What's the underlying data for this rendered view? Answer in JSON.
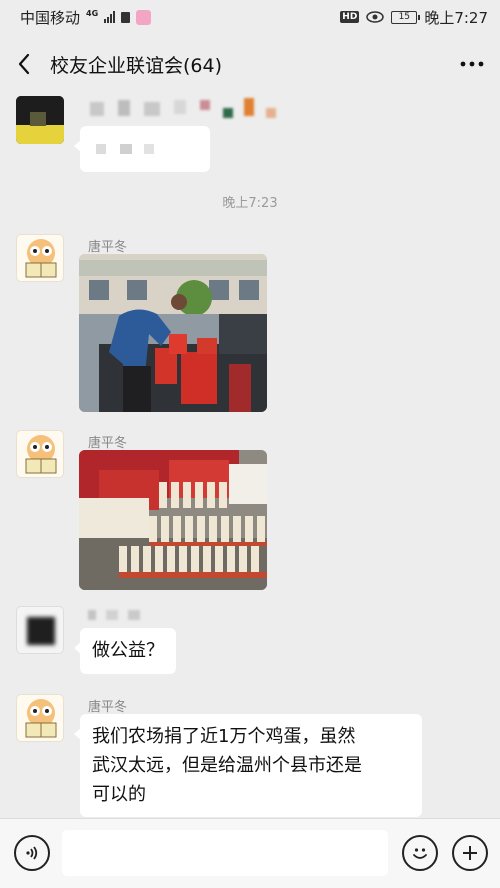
{
  "status_bar": {
    "carrier": "中国移动",
    "network": "4G",
    "hd": "HD",
    "battery": "15",
    "time": "晚上7:27"
  },
  "nav": {
    "title": "校友企业联谊会(64)",
    "back_icon": "chevron-left-icon",
    "more_icon": "more-dots-icon"
  },
  "chat": {
    "timestamp": "晚上7:23",
    "messages": [
      {
        "sender": "唐平冬",
        "type": "image",
        "description_icon": "photo-truck-loading"
      },
      {
        "sender": "唐平冬",
        "type": "image",
        "description_icon": "photo-donated-goods"
      },
      {
        "sender": "",
        "type": "text",
        "text": "做公益？"
      },
      {
        "sender": "唐平冬",
        "type": "text",
        "text_lines": [
          "我们农场捐了近1万个鸡蛋，虽然",
          "武汉太远，但是给温州个县市还是",
          "可以的"
        ]
      }
    ]
  },
  "input_bar": {
    "voice_icon": "voice-icon",
    "emoji_icon": "emoji-icon",
    "add_icon": "plus-icon",
    "value": ""
  },
  "colors": {
    "background": "#ededed",
    "bubble": "#ffffff",
    "meta_text": "#888888"
  }
}
